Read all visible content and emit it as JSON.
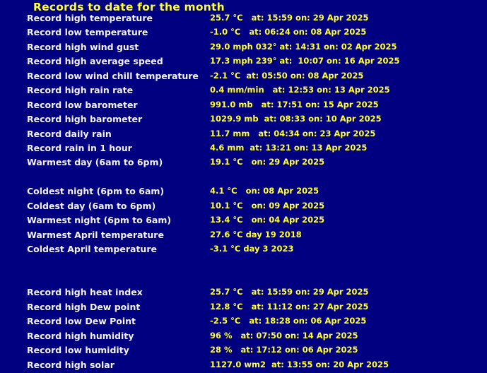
{
  "page": {
    "title": "Records to date for the month",
    "background_color": "#000080",
    "title_color": "#FFFF33",
    "label_color": "#F2F2FF",
    "value_color": "#FFFF33"
  },
  "records": [
    {
      "label": "Record high temperature",
      "value": "25.7 °C   at: 15:59 on: 29 Apr 2025"
    },
    {
      "label": "Record low temperature",
      "value": "-1.0 °C   at: 06:24 on: 08 Apr 2025"
    },
    {
      "label": "Record high wind gust",
      "value": "29.0 mph 032° at: 14:31 on: 02 Apr 2025"
    },
    {
      "label": "Record high average speed",
      "value": "17.3 mph 239° at:  10:07 on: 16 Apr 2025"
    },
    {
      "label": "Record low wind chill temperature",
      "value": "-2.1 °C  at: 05:50 on: 08 Apr 2025"
    },
    {
      "label": "Record high rain rate",
      "value": "0.4 mm/min   at: 12:53 on: 13 Apr 2025"
    },
    {
      "label": "Record low barometer",
      "value": "991.0 mb   at: 17:51 on: 15 Apr 2025"
    },
    {
      "label": "Record high barometer",
      "value": "1029.9 mb  at: 08:33 on: 10 Apr 2025"
    },
    {
      "label": "Record daily rain",
      "value": "11.7 mm   at: 04:34 on: 23 Apr 2025"
    },
    {
      "label": "Record rain in 1 hour",
      "value": "4.6 mm  at: 13:21 on: 13 Apr 2025"
    },
    {
      "label": "Warmest day (6am to 6pm)",
      "value": "19.1 °C   on: 29 Apr 2025"
    },
    {
      "label": "",
      "value": ""
    },
    {
      "label": "Coldest night (6pm to 6am)",
      "value": "4.1 °C   on: 08 Apr 2025"
    },
    {
      "label": "Coldest day (6am to 6pm)",
      "value": "10.1 °C   on: 09 Apr 2025"
    },
    {
      "label": "Warmest night (6pm to 6am)",
      "value": "13.4 °C   on: 04 Apr 2025"
    },
    {
      "label": "Warmest April temperature",
      "value": "27.6 °C day 19 2018"
    },
    {
      "label": "Coldest April temperature",
      "value": "-3.1 °C day 3 2023"
    },
    {
      "label": "",
      "value": ""
    },
    {
      "label": "",
      "value": ""
    },
    {
      "label": "Record high heat index",
      "value": "25.7 °C   at: 15:59 on: 29 Apr 2025"
    },
    {
      "label": "Record high Dew point",
      "value": "12.8 °C   at: 11:12 on: 27 Apr 2025"
    },
    {
      "label": "Record low Dew Point",
      "value": "-2.5 °C   at: 18:28 on: 06 Apr 2025"
    },
    {
      "label": "Record high humidity",
      "value": "96 %   at: 07:50 on: 14 Apr 2025"
    },
    {
      "label": "Record low humidity",
      "value": "28 %   at: 17:12 on: 06 Apr 2025"
    },
    {
      "label": "Record high solar",
      "value": "1127.0 wm2  at: 13:55 on: 20 Apr 2025"
    }
  ]
}
